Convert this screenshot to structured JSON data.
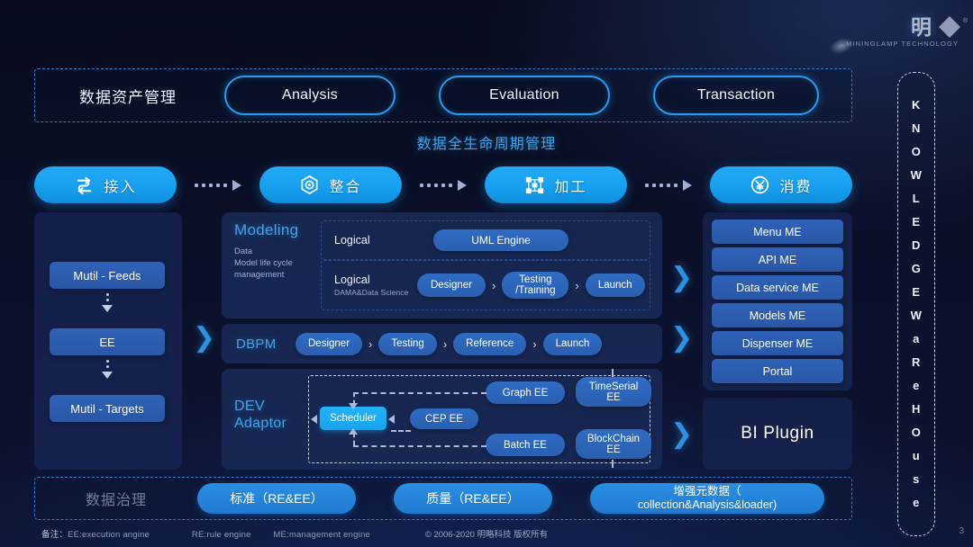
{
  "logo": {
    "glyph": "明",
    "name": "MININGLAMP TECHNOLOGY",
    "registered": "®"
  },
  "top_band": {
    "label": "数据资产管理",
    "buttons": [
      {
        "label": "Analysis"
      },
      {
        "label": "Evaluation"
      },
      {
        "label": "Transaction"
      }
    ]
  },
  "lifecycle_title": "数据全生命周期管理",
  "stages": [
    {
      "label": "接入",
      "icon": "data-ingest-icon"
    },
    {
      "label": "整合",
      "icon": "data-integrate-icon"
    },
    {
      "label": "加工",
      "icon": "data-process-icon"
    },
    {
      "label": "消费",
      "icon": "data-consume-icon"
    }
  ],
  "left_column": {
    "items": [
      {
        "label": "Mutil - Feeds"
      },
      {
        "label": "EE"
      },
      {
        "label": "Mutil - Targets"
      }
    ]
  },
  "modeling": {
    "title": "Modeling",
    "subtitle": "Data\nModel life cycle\nmanagement",
    "subtitle_lines": [
      "Data",
      "Model life cycle",
      "management"
    ],
    "row1": {
      "label": "Logical",
      "engine": "UML Engine"
    },
    "row2": {
      "label": "Logical",
      "sub_label": "DAMA&Data Science",
      "steps": [
        "Designer",
        "Testing\n/Training",
        "Launch"
      ],
      "step_labels": [
        "Designer",
        "Testing",
        "/Training",
        "Launch"
      ],
      "separator": "›"
    }
  },
  "dbpm": {
    "title": "DBPM",
    "steps": [
      "Designer",
      "Testing",
      "Reference",
      "Launch"
    ],
    "separator": "›"
  },
  "dev_adaptor": {
    "title_lines": [
      "DEV",
      "Adaptor"
    ],
    "scheduler": "Scheduler",
    "nodes": [
      {
        "label": "CEP EE"
      },
      {
        "label": "Graph EE"
      },
      {
        "label": "Batch EE"
      },
      {
        "label": "TimeSerial\nEE",
        "l1": "TimeSerial",
        "l2": "EE"
      },
      {
        "label": "BlockChain\nEE",
        "l1": "BlockChain",
        "l2": "EE"
      }
    ]
  },
  "right_column": {
    "me_items": [
      {
        "label": "Menu ME"
      },
      {
        "label": "API ME"
      },
      {
        "label": "Data service ME"
      },
      {
        "label": "Models ME"
      },
      {
        "label": "Dispenser  ME"
      },
      {
        "label": "Portal"
      }
    ],
    "bi_plugin": "BI Plugin"
  },
  "knowledge_warehouse": {
    "letters": [
      "K",
      "N",
      "O",
      "W",
      "L",
      "E",
      "D",
      "G",
      "E",
      "W",
      "a",
      "R",
      "e",
      "H",
      "O",
      "u",
      "s",
      "e"
    ]
  },
  "governance": {
    "label": "数据治理",
    "pills": [
      {
        "label": "标准（RE&EE）"
      },
      {
        "label": "质量（RE&EE）"
      },
      {
        "l1": "增强元数据（",
        "l2": "collection&Analysis&loader)"
      }
    ]
  },
  "footer": {
    "note_prefix": "备注：",
    "notes": [
      "EE:execution angine",
      "RE:rule engine",
      "ME:management engine"
    ],
    "copyright": "© 2006-2020 明略科技 版权所有",
    "page": "3"
  },
  "colors": {
    "accent_blue": "#23a9f5",
    "pill_blue": "#2f6cc4",
    "outline_blue": "#2a9bf0",
    "bg_dark": "#0a1028",
    "panel": "#16264f"
  }
}
